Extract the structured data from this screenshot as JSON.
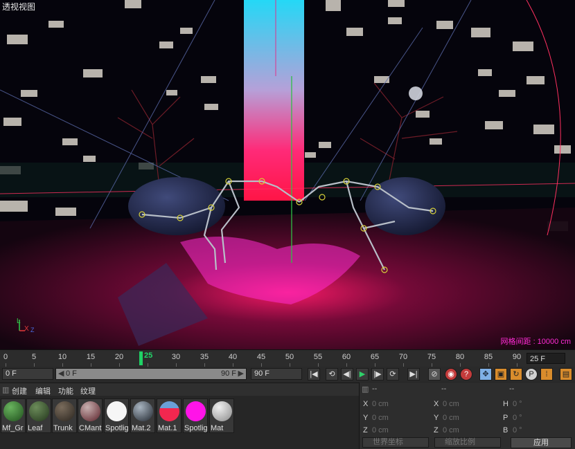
{
  "viewport": {
    "title": "透视视图",
    "grid_label": "网格间距 : 10000 cm",
    "axis_y": "L",
    "axis_x": "X",
    "axis_z": "Z"
  },
  "timeline": {
    "ticks": [
      "0",
      "5",
      "10",
      "15",
      "20",
      "25",
      "30",
      "35",
      "40",
      "45",
      "50",
      "55",
      "60",
      "65",
      "70",
      "75",
      "80",
      "85",
      "90"
    ],
    "current_frame": "25",
    "frame_display": "25 F"
  },
  "transport": {
    "start_field": "0 F",
    "range_start": "0 F",
    "range_end": "90 F",
    "end_field": "90 F",
    "buttons": [
      "|◀",
      "⟲",
      "◀|",
      "▶",
      "|▶",
      "⟳",
      "▶|"
    ]
  },
  "materials": {
    "menu": [
      "创建",
      "编辑",
      "功能",
      "纹理"
    ],
    "items": [
      {
        "name": "Mf_Gr",
        "color": "#2f7a2a"
      },
      {
        "name": "Leaf",
        "color": "#3c5a30"
      },
      {
        "name": "Trunk",
        "color": "#4a4036"
      },
      {
        "name": "CMant",
        "color": "#7a4046"
      },
      {
        "name": "Spotlig",
        "color": "#f4f4f4"
      },
      {
        "name": "Mat.2",
        "color": "#4a5560"
      },
      {
        "name": "Mat.1",
        "color": "#f2274f"
      },
      {
        "name": "Spotlig",
        "color": "#ff14e8"
      },
      {
        "name": "Mat",
        "color": "#cfcfcf"
      }
    ]
  },
  "coordinates": {
    "header": [
      "--",
      "--",
      "--"
    ],
    "rows": [
      {
        "l1": "X",
        "v1": "0 cm",
        "l2": "X",
        "v2": "0 cm",
        "l3": "H",
        "v3": "0 °"
      },
      {
        "l1": "Y",
        "v1": "0 cm",
        "l2": "Y",
        "v2": "0 cm",
        "l3": "P",
        "v3": "0 °"
      },
      {
        "l1": "Z",
        "v1": "0 cm",
        "l2": "Z",
        "v2": "0 cm",
        "l3": "B",
        "v3": "0 °"
      }
    ],
    "world_dropdown": "世界坐标",
    "scale_dropdown": "缩放比例",
    "apply_button": "应用"
  }
}
